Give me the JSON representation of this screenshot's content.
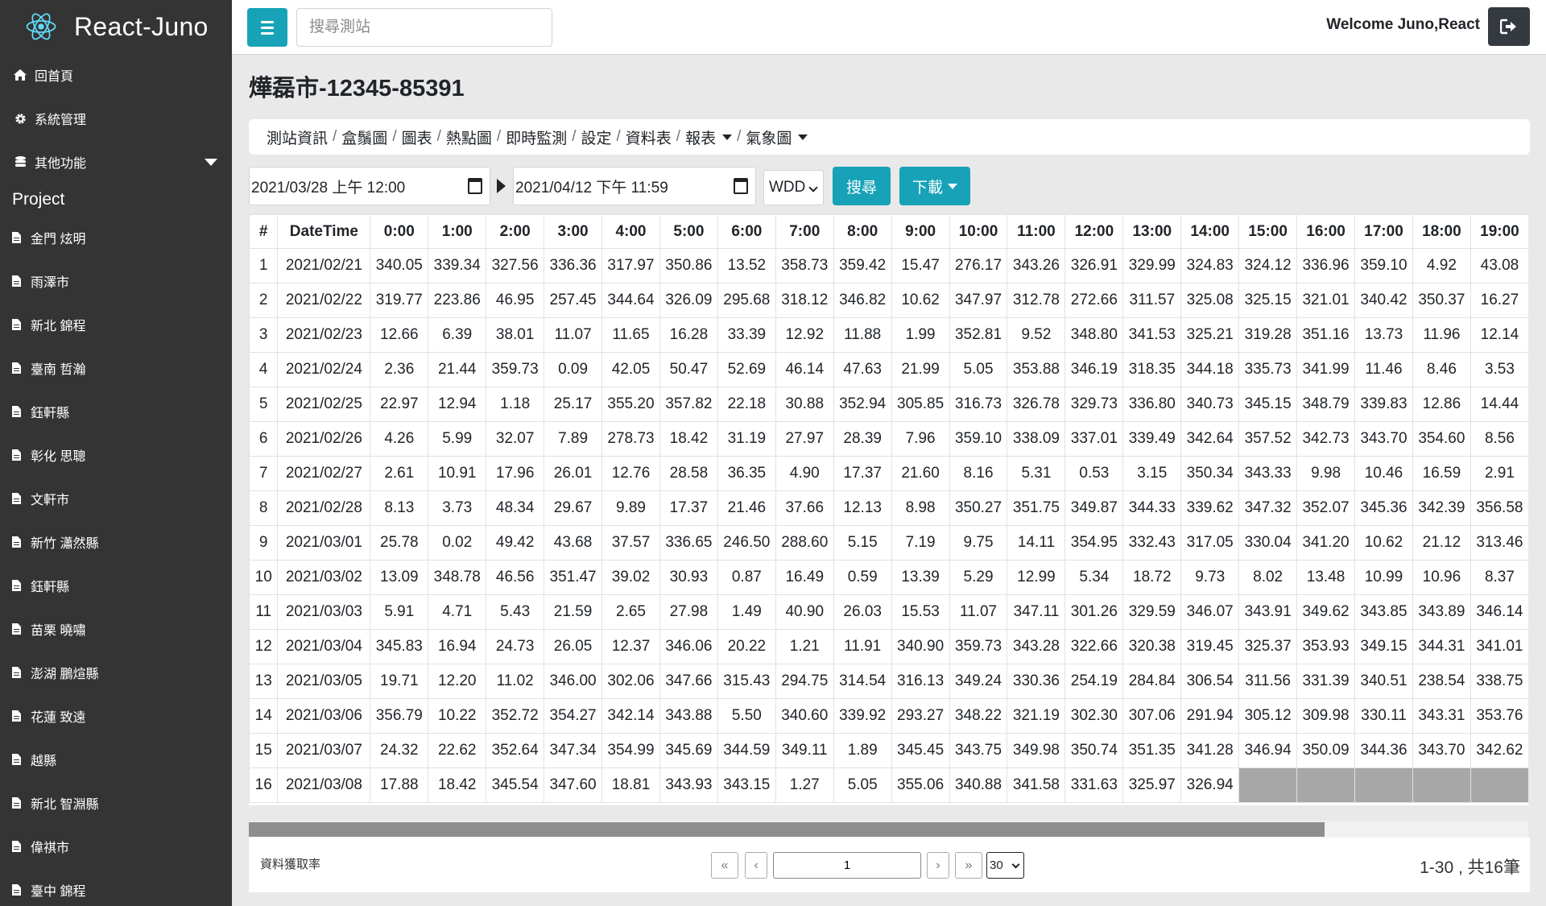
{
  "sidebar": {
    "brand": "React-Juno",
    "menu": [
      {
        "label": "回首頁",
        "icon": "home-icon"
      },
      {
        "label": "系統管理",
        "icon": "gear-icon"
      },
      {
        "label": "其他功能",
        "icon": "database-icon"
      }
    ],
    "project_title": "Project",
    "projects": [
      "金門 炫明",
      "雨澤市",
      "新北 錦程",
      "臺南 哲瀚",
      "鈺軒縣",
      "彰化 思聰",
      "文軒市",
      "新竹 瀟然縣",
      "鈺軒縣",
      "苗栗 曉嘯",
      "澎湖 鵬煊縣",
      "花蓮 致遠",
      "越縣",
      "新北 智淵縣",
      "偉祺市",
      "臺中 錦程"
    ]
  },
  "topbar": {
    "search_placeholder": "搜尋測站",
    "welcome": "Welcome Juno,React"
  },
  "page_title": "燁磊市-12345-85391",
  "nav": {
    "items": [
      "測站資訊",
      "盒鬚圖",
      "圖表",
      "熱點圖",
      "即時監測",
      "設定",
      "資料表",
      "報表",
      "氣象圖"
    ],
    "separator": "/"
  },
  "filters": {
    "start": "2021/03/28 上午 12:00",
    "end": "2021/04/12 下午 11:59",
    "param": "WDD",
    "search_label": "搜尋",
    "download_label": "下載"
  },
  "table": {
    "headers": [
      "#",
      "DateTime",
      "0:00",
      "1:00",
      "2:00",
      "3:00",
      "4:00",
      "5:00",
      "6:00",
      "7:00",
      "8:00",
      "9:00",
      "10:00",
      "11:00",
      "12:00",
      "13:00",
      "14:00",
      "15:00",
      "16:00",
      "17:00",
      "18:00",
      "19:00"
    ],
    "rows": [
      [
        "1",
        "2021/02/21",
        "340.05",
        "339.34",
        "327.56",
        "336.36",
        "317.97",
        "350.86",
        "13.52",
        "358.73",
        "359.42",
        "15.47",
        "276.17",
        "343.26",
        "326.91",
        "329.99",
        "324.83",
        "324.12",
        "336.96",
        "359.10",
        "4.92",
        "43.08"
      ],
      [
        "2",
        "2021/02/22",
        "319.77",
        "223.86",
        "46.95",
        "257.45",
        "344.64",
        "326.09",
        "295.68",
        "318.12",
        "346.82",
        "10.62",
        "347.97",
        "312.78",
        "272.66",
        "311.57",
        "325.08",
        "325.15",
        "321.01",
        "340.42",
        "350.37",
        "16.27"
      ],
      [
        "3",
        "2021/02/23",
        "12.66",
        "6.39",
        "38.01",
        "11.07",
        "11.65",
        "16.28",
        "33.39",
        "12.92",
        "11.88",
        "1.99",
        "352.81",
        "9.52",
        "348.80",
        "341.53",
        "325.21",
        "319.28",
        "351.16",
        "13.73",
        "11.96",
        "12.14"
      ],
      [
        "4",
        "2021/02/24",
        "2.36",
        "21.44",
        "359.73",
        "0.09",
        "42.05",
        "50.47",
        "52.69",
        "46.14",
        "47.63",
        "21.99",
        "5.05",
        "353.88",
        "346.19",
        "318.35",
        "344.18",
        "335.73",
        "341.99",
        "11.46",
        "8.46",
        "3.53"
      ],
      [
        "5",
        "2021/02/25",
        "22.97",
        "12.94",
        "1.18",
        "25.17",
        "355.20",
        "357.82",
        "22.18",
        "30.88",
        "352.94",
        "305.85",
        "316.73",
        "326.78",
        "329.73",
        "336.80",
        "340.73",
        "345.15",
        "348.79",
        "339.83",
        "12.86",
        "14.44"
      ],
      [
        "6",
        "2021/02/26",
        "4.26",
        "5.99",
        "32.07",
        "7.89",
        "278.73",
        "18.42",
        "31.19",
        "27.97",
        "28.39",
        "7.96",
        "359.10",
        "338.09",
        "337.01",
        "339.49",
        "342.64",
        "357.52",
        "342.73",
        "343.70",
        "354.60",
        "8.56"
      ],
      [
        "7",
        "2021/02/27",
        "2.61",
        "10.91",
        "17.96",
        "26.01",
        "12.76",
        "28.58",
        "36.35",
        "4.90",
        "17.37",
        "21.60",
        "8.16",
        "5.31",
        "0.53",
        "3.15",
        "350.34",
        "343.33",
        "9.98",
        "10.46",
        "16.59",
        "2.91"
      ],
      [
        "8",
        "2021/02/28",
        "8.13",
        "3.73",
        "48.34",
        "29.67",
        "9.89",
        "17.37",
        "21.46",
        "37.66",
        "12.13",
        "8.98",
        "350.27",
        "351.75",
        "349.87",
        "344.33",
        "339.62",
        "347.32",
        "352.07",
        "345.36",
        "342.39",
        "356.58"
      ],
      [
        "9",
        "2021/03/01",
        "25.78",
        "0.02",
        "49.42",
        "43.68",
        "37.57",
        "336.65",
        "246.50",
        "288.60",
        "5.15",
        "7.19",
        "9.75",
        "14.11",
        "354.95",
        "332.43",
        "317.05",
        "330.04",
        "341.20",
        "10.62",
        "21.12",
        "313.46"
      ],
      [
        "10",
        "2021/03/02",
        "13.09",
        "348.78",
        "46.56",
        "351.47",
        "39.02",
        "30.93",
        "0.87",
        "16.49",
        "0.59",
        "13.39",
        "5.29",
        "12.99",
        "5.34",
        "18.72",
        "9.73",
        "8.02",
        "13.48",
        "10.99",
        "10.96",
        "8.37"
      ],
      [
        "11",
        "2021/03/03",
        "5.91",
        "4.71",
        "5.43",
        "21.59",
        "2.65",
        "27.98",
        "1.49",
        "40.90",
        "26.03",
        "15.53",
        "11.07",
        "347.11",
        "301.26",
        "329.59",
        "346.07",
        "343.91",
        "349.62",
        "343.85",
        "343.89",
        "346.14"
      ],
      [
        "12",
        "2021/03/04",
        "345.83",
        "16.94",
        "24.73",
        "26.05",
        "12.37",
        "346.06",
        "20.22",
        "1.21",
        "11.91",
        "340.90",
        "359.73",
        "343.28",
        "322.66",
        "320.38",
        "319.45",
        "325.37",
        "353.93",
        "349.15",
        "344.31",
        "341.01"
      ],
      [
        "13",
        "2021/03/05",
        "19.71",
        "12.20",
        "11.02",
        "346.00",
        "302.06",
        "347.66",
        "315.43",
        "294.75",
        "314.54",
        "316.13",
        "349.24",
        "330.36",
        "254.19",
        "284.84",
        "306.54",
        "311.56",
        "331.39",
        "340.51",
        "238.54",
        "338.75"
      ],
      [
        "14",
        "2021/03/06",
        "356.79",
        "10.22",
        "352.72",
        "354.27",
        "342.14",
        "343.88",
        "5.50",
        "340.60",
        "339.92",
        "293.27",
        "348.22",
        "321.19",
        "302.30",
        "307.06",
        "291.94",
        "305.12",
        "309.98",
        "330.11",
        "343.31",
        "353.76"
      ],
      [
        "15",
        "2021/03/07",
        "24.32",
        "22.62",
        "352.64",
        "347.34",
        "354.99",
        "345.69",
        "344.59",
        "349.11",
        "1.89",
        "345.45",
        "343.75",
        "349.98",
        "350.74",
        "351.35",
        "341.28",
        "346.94",
        "350.09",
        "344.36",
        "343.70",
        "342.62"
      ],
      [
        "16",
        "2021/03/08",
        "17.88",
        "18.42",
        "345.54",
        "347.60",
        "18.81",
        "343.93",
        "343.15",
        "1.27",
        "5.05",
        "355.06",
        "340.88",
        "341.58",
        "331.63",
        "325.97",
        "326.94",
        "",
        "",
        "",
        "",
        ""
      ]
    ]
  },
  "footer": {
    "rate_label": "資料獲取率",
    "page": "1",
    "page_size": "30",
    "range_text": "1-30 , 共16筆"
  }
}
